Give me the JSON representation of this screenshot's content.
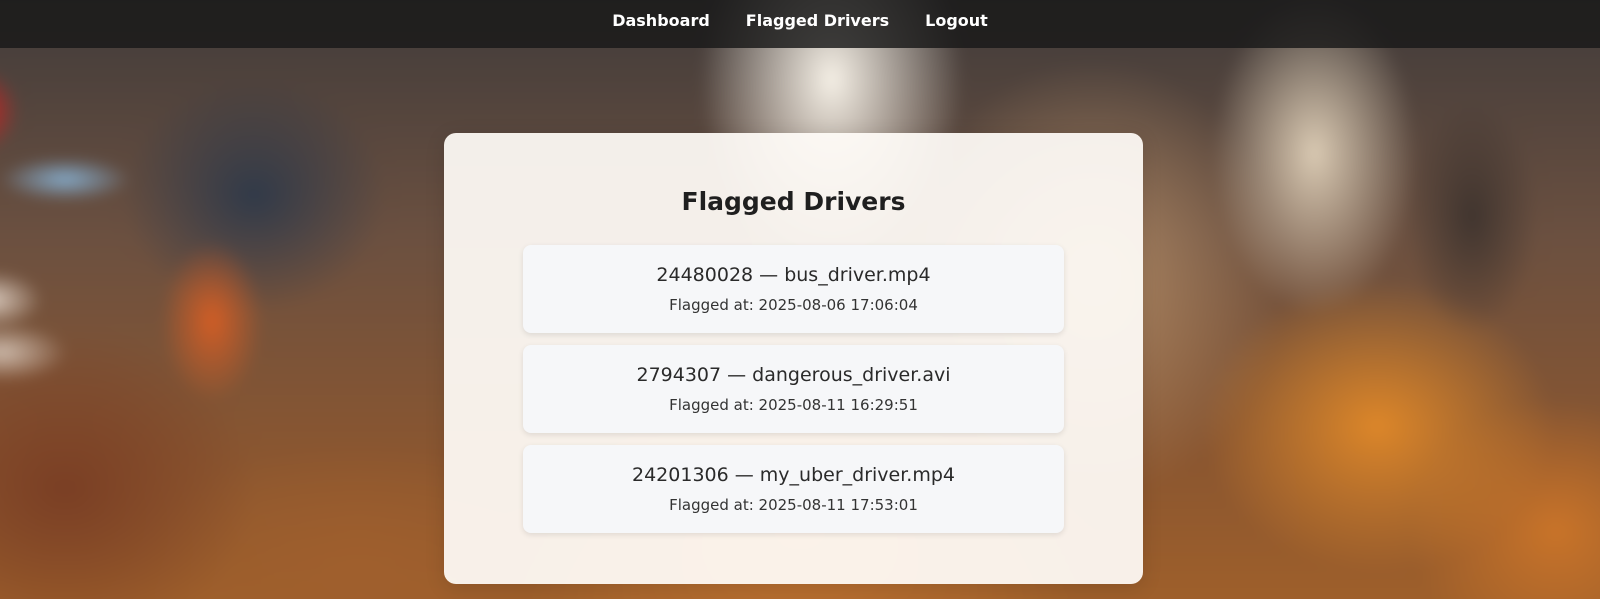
{
  "nav": {
    "items": [
      {
        "label": "Dashboard"
      },
      {
        "label": "Flagged Drivers"
      },
      {
        "label": "Logout"
      }
    ]
  },
  "main": {
    "title": "Flagged Drivers",
    "entries": [
      {
        "title": "24480028 — bus_driver.mp4",
        "flagged": "Flagged at: 2025-08-06 17:06:04"
      },
      {
        "title": "2794307 — dangerous_driver.avi",
        "flagged": "Flagged at: 2025-08-11 16:29:51"
      },
      {
        "title": "24201306 — my_uber_driver.mp4",
        "flagged": "Flagged at: 2025-08-11 17:53:01"
      }
    ]
  }
}
